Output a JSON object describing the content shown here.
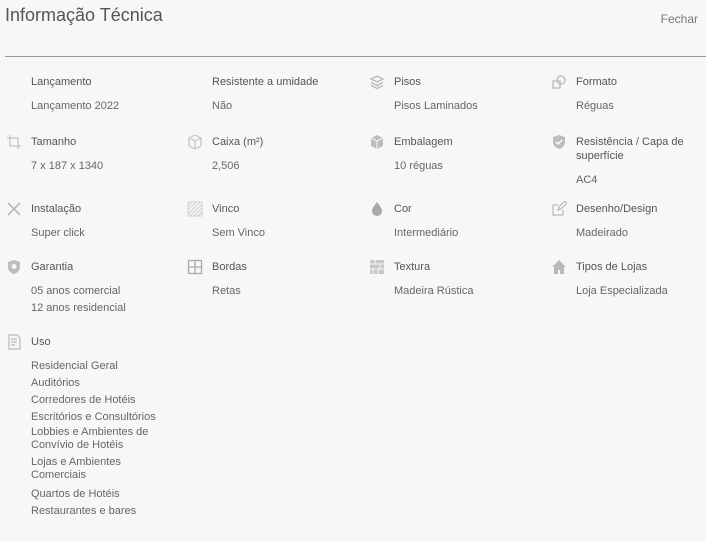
{
  "header": {
    "title": "Informação Técnica",
    "close_label": "Fechar"
  },
  "items": [
    {
      "label": "Lançamento",
      "icon": "none",
      "values": [
        "Lançamento 2022"
      ]
    },
    {
      "label": "Resistente a umidade",
      "icon": "none",
      "values": [
        "Não"
      ]
    },
    {
      "label": "Pisos",
      "icon": "layers-icon",
      "values": [
        "Pisos Laminados"
      ]
    },
    {
      "label": "Formato",
      "icon": "shapes-icon",
      "values": [
        "Réguas"
      ]
    },
    {
      "label": "Tamanho",
      "icon": "crop-icon",
      "values": [
        "7 x 187 x 1340"
      ]
    },
    {
      "label": "Caixa (m²)",
      "icon": "box-icon",
      "values": [
        "2,506"
      ]
    },
    {
      "label": "Embalagem",
      "icon": "package-icon",
      "values": [
        "10 réguas"
      ]
    },
    {
      "label": "Resistência / Capa de superfície",
      "icon": "shield-check-icon",
      "values": [
        "AC4"
      ]
    },
    {
      "label": "Instalação",
      "icon": "tools-icon",
      "values": [
        "Super click"
      ]
    },
    {
      "label": "Vinco",
      "icon": "hatch-icon",
      "values": [
        "Sem Vinco"
      ]
    },
    {
      "label": "Cor",
      "icon": "drop-icon",
      "values": [
        "Intermediário"
      ]
    },
    {
      "label": "Desenho/Design",
      "icon": "edit-icon",
      "values": [
        "Madeirado"
      ]
    },
    {
      "label": "Garantia",
      "icon": "shield-icon",
      "values": [
        "05 anos comercial",
        "12 anos residencial"
      ]
    },
    {
      "label": "Bordas",
      "icon": "grid-icon",
      "values": [
        "Retas"
      ]
    },
    {
      "label": "Textura",
      "icon": "texture-icon",
      "values": [
        "Madeira Rústica"
      ]
    },
    {
      "label": "Tipos de Lojas",
      "icon": "home-icon",
      "values": [
        "Loja Especializada"
      ]
    },
    {
      "label": "Uso",
      "icon": "document-icon",
      "values": [
        "Residencial Geral",
        "Auditórios",
        "Corredores de Hotéis",
        "Escritórios e Consultórios",
        "Lobbies e Ambientes de Convívio de Hotéis",
        "Lojas e Ambientes Comerciais",
        "Quartos de Hotéis",
        "Restaurantes e bares"
      ]
    }
  ]
}
